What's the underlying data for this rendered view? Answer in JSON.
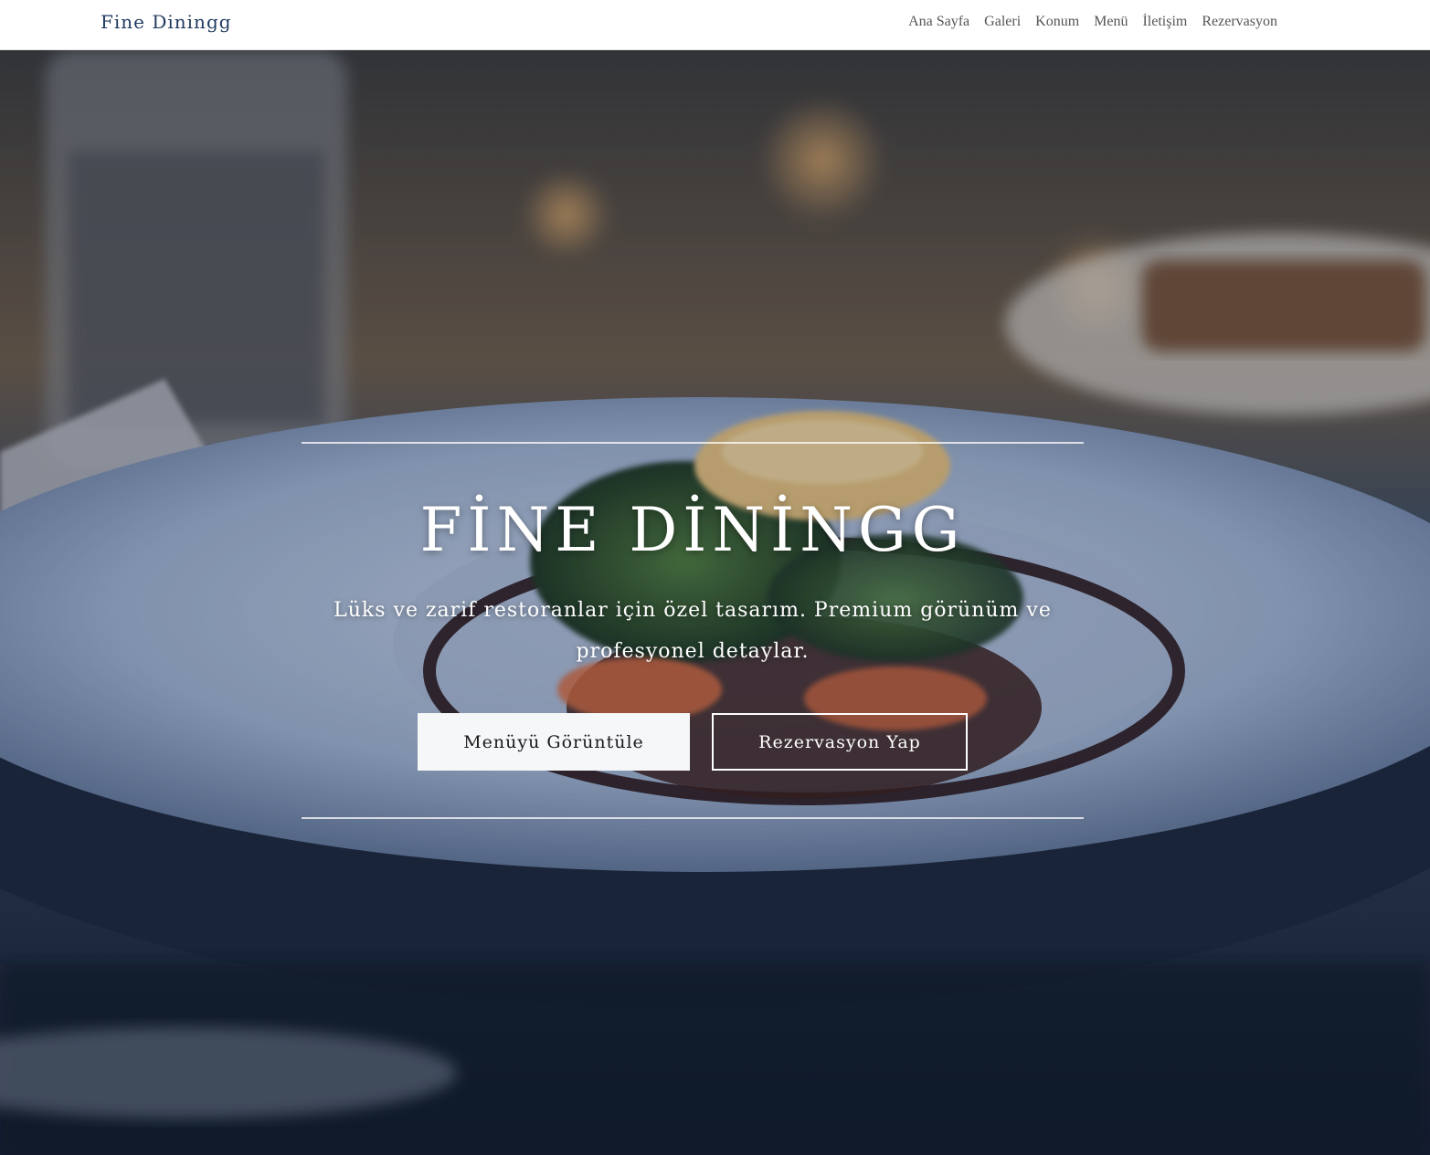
{
  "navbar": {
    "brand": "Fine Diningg",
    "links": [
      "Ana Sayfa",
      "Galeri",
      "Konum",
      "Menü",
      "İletişim",
      "Rezervasyon"
    ]
  },
  "hero": {
    "title": "FİNE DİNİNGG",
    "subtitle": "Lüks ve zarif restoranlar için özel tasarım. Premium görünüm ve profesyonel detaylar.",
    "primary_button": "Menüyü Görüntüle",
    "secondary_button": "Rezervasyon Yap",
    "background_description_icon": "plated-dish-photo"
  },
  "colors": {
    "brand": "#1f3a5f",
    "nav_text": "#555555",
    "hero_text": "#ffffff",
    "primary_button_bg": "#f6f7f9"
  }
}
